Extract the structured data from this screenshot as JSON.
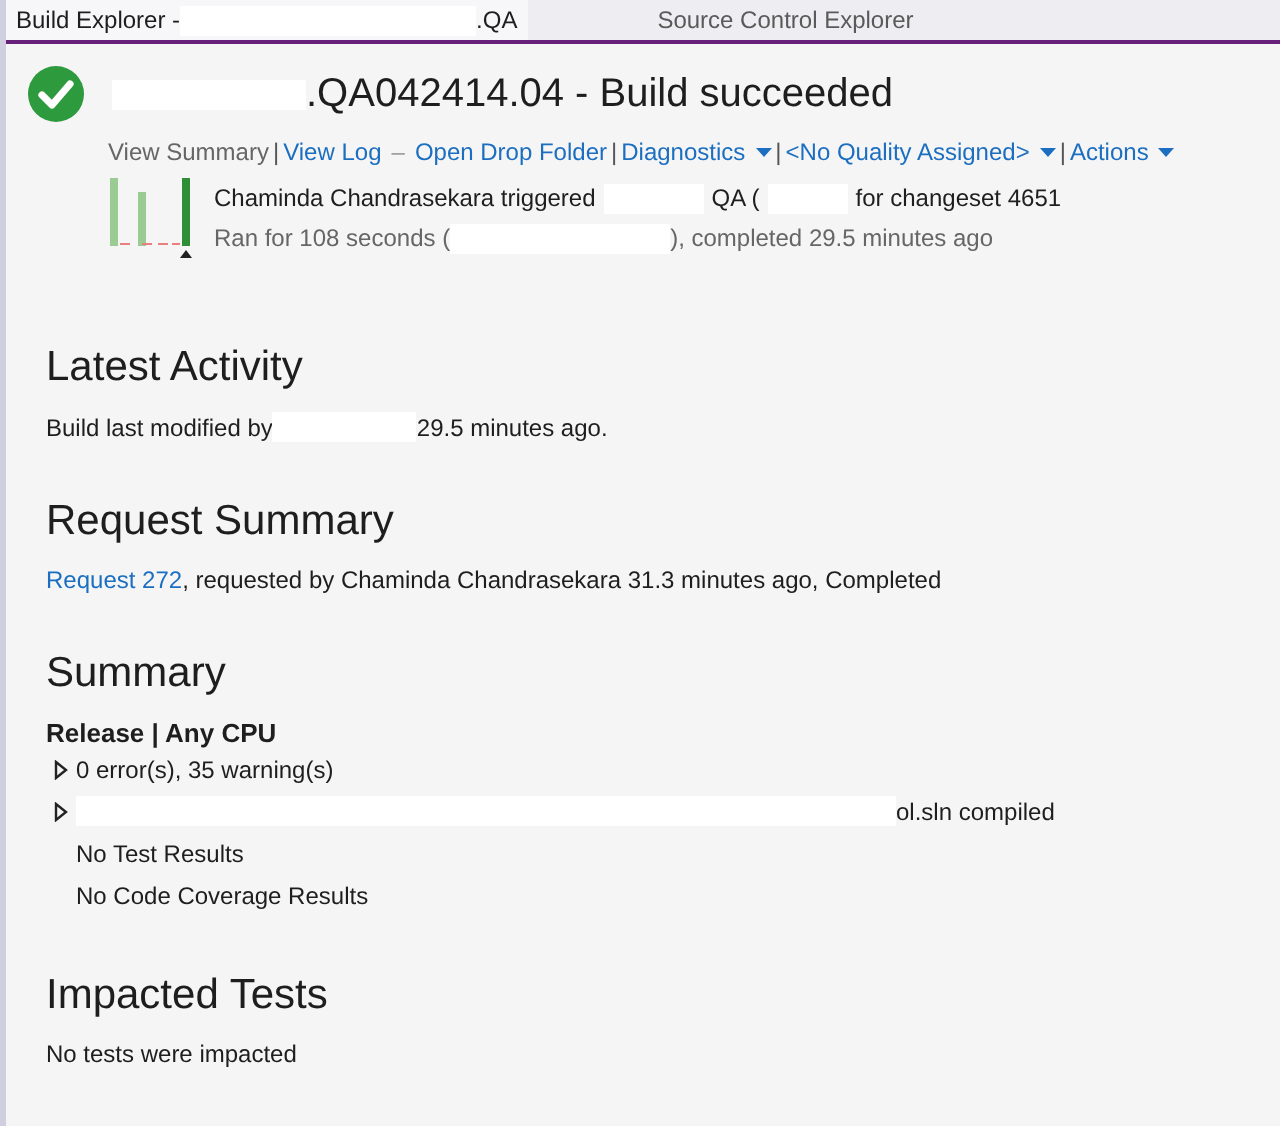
{
  "tabs": [
    {
      "parts": [
        {
          "kind": "text",
          "text": "Build Explorer -"
        },
        {
          "kind": "redacted"
        },
        {
          "kind": "text",
          "text": ".QA"
        }
      ],
      "selected": true
    },
    {
      "parts": [
        {
          "kind": "text",
          "text": "Source Control Explorer"
        }
      ],
      "selected": false
    }
  ],
  "build": {
    "title": [
      {
        "kind": "redacted"
      },
      {
        "kind": "text",
        "text": ".QA042414.04 - Build succeeded"
      }
    ],
    "actions": [
      {
        "kind": "link",
        "label": "View Summary",
        "selected": true
      },
      {
        "kind": "separator",
        "label": "|"
      },
      {
        "kind": "link",
        "label": "View Log",
        "selected": false
      },
      {
        "kind": "separator",
        "label": "–"
      },
      {
        "kind": "link",
        "label": "Open Drop Folder",
        "selected": false
      },
      {
        "kind": "separator",
        "label": "|"
      },
      {
        "kind": "dropdown",
        "label": "Diagnostics",
        "selected": false
      },
      {
        "kind": "separator",
        "label": "|"
      },
      {
        "kind": "dropdown",
        "label": "<No Quality Assigned>",
        "selected": false
      },
      {
        "kind": "separator",
        "label": "|"
      },
      {
        "kind": "dropdown",
        "label": "Actions",
        "selected": false
      }
    ],
    "trigger_line": [
      {
        "kind": "text",
        "text": "Chaminda Chandrasekara triggered"
      },
      {
        "kind": "redacted"
      },
      {
        "kind": "text",
        "text": "QA ("
      },
      {
        "kind": "redacted"
      },
      {
        "kind": "text",
        "text": "for changeset 4651"
      }
    ],
    "duration_line": [
      {
        "kind": "text",
        "text": "Ran for 108 seconds ("
      },
      {
        "kind": "redacted"
      },
      {
        "kind": "text",
        "text": "), completed 29.5 minutes ago"
      }
    ]
  },
  "latest_activity": {
    "heading": "Latest Activity",
    "line": [
      {
        "kind": "text",
        "text": "Build last modified by"
      },
      {
        "kind": "redacted"
      },
      {
        "kind": "text",
        "text": "29.5 minutes ago."
      }
    ]
  },
  "request_summary": {
    "heading": "Request Summary",
    "link": "Request 272",
    "text": ", requested by Chaminda Chandrasekara 31.3 minutes ago, Completed"
  },
  "summary": {
    "heading": "Summary",
    "configuration": "Release | Any CPU",
    "items": [
      {
        "expandable": true,
        "parts": [
          {
            "kind": "text",
            "text": "0 error(s), 35 warning(s)"
          }
        ]
      },
      {
        "expandable": true,
        "parts": [
          {
            "kind": "redacted"
          },
          {
            "kind": "text",
            "text": "ol.sln compiled"
          }
        ]
      },
      {
        "expandable": false,
        "parts": [
          {
            "kind": "text",
            "text": "No Test Results"
          }
        ]
      },
      {
        "expandable": false,
        "parts": [
          {
            "kind": "text",
            "text": "No Code Coverage Results"
          }
        ]
      }
    ]
  },
  "impacted_tests": {
    "heading": "Impacted Tests",
    "text": "No tests were impacted"
  }
}
